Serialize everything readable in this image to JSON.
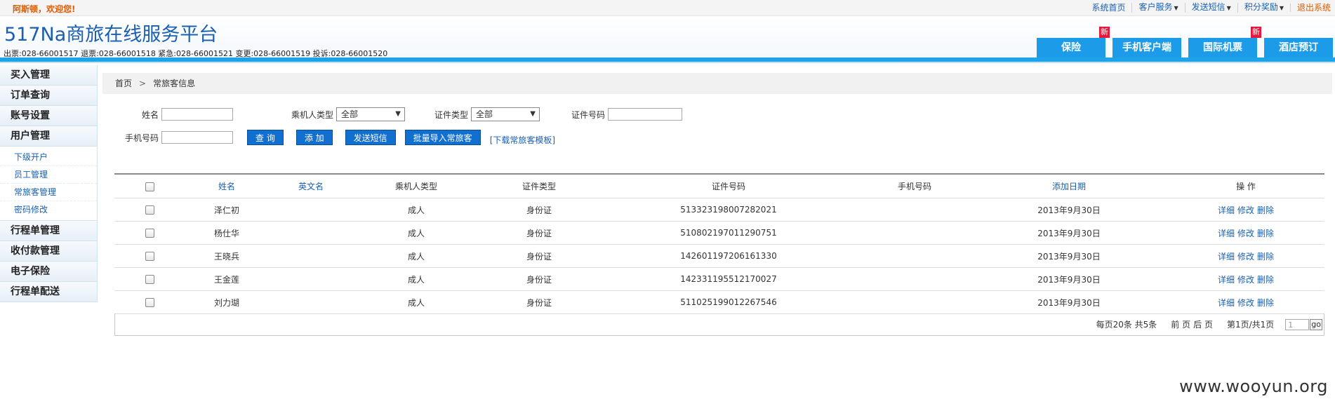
{
  "topbar": {
    "welcome": "阿斯顿，欢迎您!",
    "links": [
      {
        "label": "系统首页",
        "dropdown": false
      },
      {
        "label": "客户服务",
        "dropdown": true
      },
      {
        "label": "发送短信",
        "dropdown": true
      },
      {
        "label": "积分奖励",
        "dropdown": true
      }
    ],
    "logout": "退出系统"
  },
  "header": {
    "brand": "517Na商旅在线服务平台",
    "hotlines": "出票:028-66001517 退票:028-66001518 紧急:028-66001521 变更:028-66001519 投诉:028-66001520",
    "nav": [
      {
        "label": "保险",
        "new_tag": "新"
      },
      {
        "label": "手机客户端",
        "new_tag": ""
      },
      {
        "label": "国际机票",
        "new_tag": "新"
      },
      {
        "label": "酒店预订",
        "new_tag": ""
      }
    ]
  },
  "sidebar": {
    "cats_top": [
      "买入管理",
      "订单查询",
      "账号设置",
      "用户管理"
    ],
    "subs": [
      "下级开户",
      "员工管理",
      "常旅客管理",
      "密码修改"
    ],
    "cats_bottom": [
      "行程单管理",
      "收付款管理",
      "电子保险",
      "行程单配送"
    ]
  },
  "breadcrumb": {
    "home": "首页",
    "sep": ">",
    "current": "常旅客信息"
  },
  "search": {
    "name_label": "姓名",
    "passenger_type_label": "乘机人类型",
    "passenger_type_value": "全部",
    "id_type_label": "证件类型",
    "id_type_value": "全部",
    "id_no_label": "证件号码",
    "phone_label": "手机号码",
    "query_btn": "查 询",
    "add_btn": "添 加",
    "sms_btn": "发送短信",
    "import_btn": "批量导入常旅客",
    "download_link": "[下载常旅客模板]"
  },
  "table": {
    "headers": [
      "姓名",
      "英文名",
      "乘机人类型",
      "证件类型",
      "证件号码",
      "手机号码",
      "添加日期",
      "操 作"
    ],
    "rows": [
      {
        "name": "泽仁初",
        "en_name": "",
        "ptype": "成人",
        "id_type": "身份证",
        "id_no": "513323198007282021",
        "phone": "",
        "date": "2013年9月30日"
      },
      {
        "name": "杨仕华",
        "en_name": "",
        "ptype": "成人",
        "id_type": "身份证",
        "id_no": "510802197011290751",
        "phone": "",
        "date": "2013年9月30日"
      },
      {
        "name": "王晓兵",
        "en_name": "",
        "ptype": "成人",
        "id_type": "身份证",
        "id_no": "142601197206161330",
        "phone": "",
        "date": "2013年9月30日"
      },
      {
        "name": "王金莲",
        "en_name": "",
        "ptype": "成人",
        "id_type": "身份证",
        "id_no": "142331195512170027",
        "phone": "",
        "date": "2013年9月30日"
      },
      {
        "name": "刘力瑚",
        "en_name": "",
        "ptype": "成人",
        "id_type": "身份证",
        "id_no": "511025199012267546",
        "phone": "",
        "date": "2013年9月30日"
      }
    ],
    "ops": [
      "详细",
      "修改",
      "删除"
    ]
  },
  "pager": {
    "per_page": "每页20条 共5条",
    "first": "前 页",
    "next": "后 页",
    "page_info": "第1页/共1页",
    "page_input": "1",
    "go": "go"
  },
  "watermark": "www.wooyun.org"
}
